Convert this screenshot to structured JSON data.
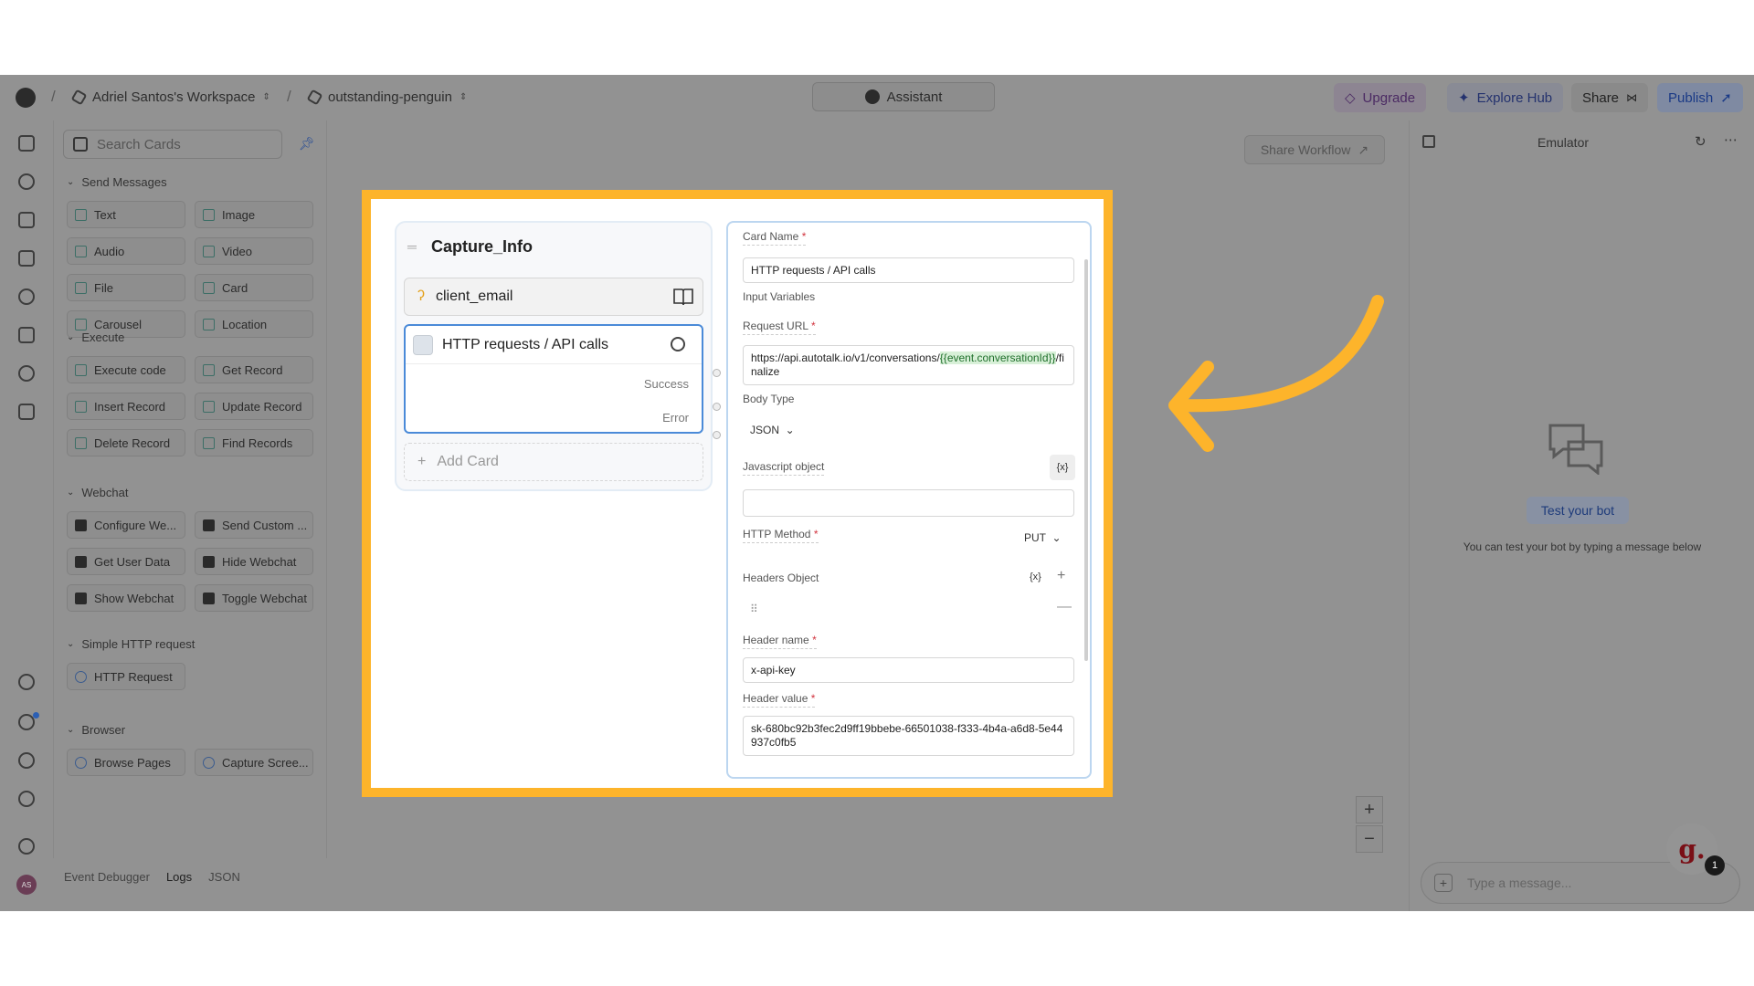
{
  "topbar": {
    "workspace": "Adriel Santos's Workspace",
    "project": "outstanding-penguin",
    "assistant": "Assistant",
    "upgrade": "Upgrade",
    "explore_hub": "Explore Hub",
    "share": "Share",
    "publish": "Publish"
  },
  "cards": {
    "search_placeholder": "Search Cards",
    "sections": [
      {
        "title": "Send Messages",
        "items": [
          "Text",
          "Image",
          "Audio",
          "Video",
          "File",
          "Card",
          "Carousel",
          "Location"
        ]
      },
      {
        "title": "Execute",
        "items": [
          "Execute code",
          "Get Record",
          "Insert Record",
          "Update Record",
          "Delete Record",
          "Find Records"
        ]
      },
      {
        "title": "Webchat",
        "items": [
          "Configure We...",
          "Send Custom ...",
          "Get User Data",
          "Hide Webchat",
          "Show Webchat",
          "Toggle Webchat"
        ]
      },
      {
        "title": "Simple HTTP request",
        "items": [
          "HTTP Request"
        ]
      },
      {
        "title": "Browser",
        "items": [
          "Browse Pages",
          "Capture Scree..."
        ]
      }
    ]
  },
  "bottombar": {
    "tabs": [
      "Event Debugger",
      "Logs",
      "JSON"
    ],
    "active": "Logs"
  },
  "canvas": {
    "share_workflow": "Share Workflow"
  },
  "node": {
    "title": "Capture_Info",
    "email_card": "client_email",
    "http_card": "HTTP requests / API calls",
    "success": "Success",
    "error": "Error",
    "add_card": "Add Card"
  },
  "form": {
    "card_name_label": "Card Name",
    "card_name_value": "HTTP requests / API calls",
    "input_variables_label": "Input Variables",
    "request_url_label": "Request URL",
    "url_prefix": "https://api.autotalk.io/v1/conversations/",
    "url_variable": "{{event.conversationId}}",
    "url_suffix": "/finalize",
    "body_type_label": "Body Type",
    "body_type_value": "JSON",
    "js_object_label": "Javascript object",
    "var_button": "{x}",
    "http_method_label": "HTTP Method",
    "http_method_value": "PUT",
    "headers_object_label": "Headers Object",
    "header_name_label": "Header name",
    "header_name_value": "x-api-key",
    "header_value_label": "Header value",
    "header_value_value": "sk-680bc92b3fec2d9ff19bbebe-66501038-f333-4b4a-a6d8-5e44937c0fb5",
    "required_mark": "*"
  },
  "emulator": {
    "title": "Emulator",
    "test_button": "Test your bot",
    "hint": "You can test your bot by typing a message below",
    "message_placeholder": "Type a message...",
    "avatar_initials": "AS",
    "badge_letter": "g.",
    "badge_count": "1"
  },
  "colors": {
    "highlight": "#fdb42b",
    "accent": "#4a8ad8",
    "overlay": "#929292"
  }
}
